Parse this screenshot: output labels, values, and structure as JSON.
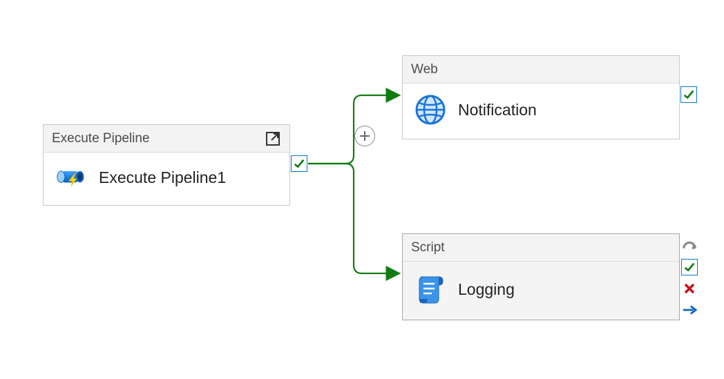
{
  "activities": {
    "execute_pipeline": {
      "type_label": "Execute Pipeline",
      "name": "Execute Pipeline1"
    },
    "web": {
      "type_label": "Web",
      "name": "Notification"
    },
    "script": {
      "type_label": "Script",
      "name": "Logging"
    }
  },
  "connections": [
    {
      "from": "execute_pipeline",
      "to": "web",
      "condition": "success"
    },
    {
      "from": "execute_pipeline",
      "to": "script",
      "condition": "success"
    }
  ],
  "colors": {
    "success": "#107c10",
    "accent": "#0078d4",
    "fail": "#c50f1f",
    "skip": "#8a8a8a"
  }
}
